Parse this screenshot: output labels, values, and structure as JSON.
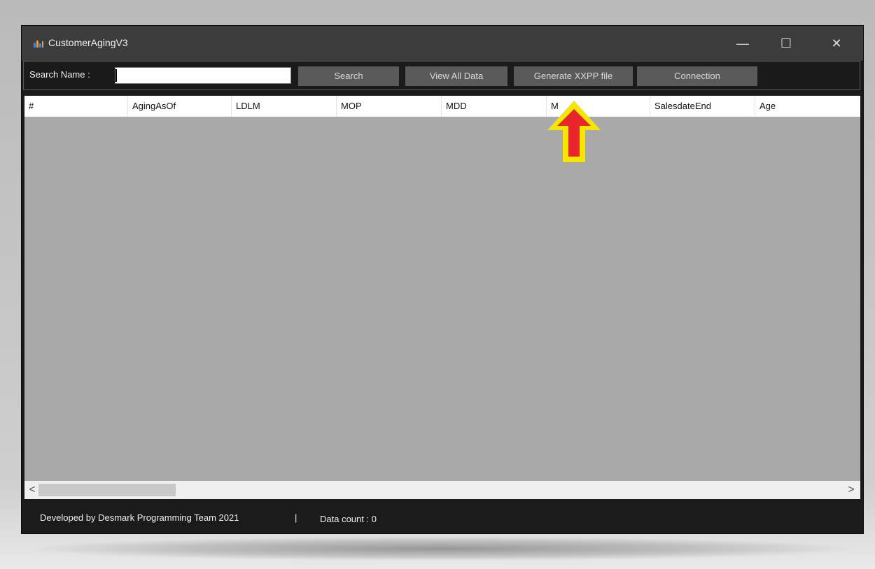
{
  "window": {
    "title": "CustomerAgingV3",
    "minimize_icon": "minimize-icon",
    "maximize_icon": "maximize-icon",
    "close_icon": "close-icon",
    "minimize_glyph": "—",
    "maximize_glyph": "☐",
    "close_glyph": "✕"
  },
  "toolbar": {
    "search_label": "Search Name :",
    "search_value": "",
    "search_button": "Search",
    "view_all_button": "View All Data",
    "generate_button": "Generate XXPP file",
    "connection_button": "Connection"
  },
  "grid": {
    "columns": [
      "#",
      "AgingAsOf",
      "LDLM",
      "MOP",
      "MDD",
      "M",
      "SalesdateEnd",
      "Age"
    ],
    "rows": []
  },
  "scrollbar": {
    "left_glyph": "<",
    "right_glyph": ">"
  },
  "status": {
    "developer": "Developed by Desmark Programming Team 2021",
    "separator": "|",
    "data_count": "Data count : 0"
  },
  "annotation": {
    "icon": "up-arrow-icon",
    "fill_color": "#e8262b",
    "outline_color": "#f5e500"
  },
  "colors": {
    "titlebar": "#3c3c3c",
    "toolbar": "#1a1a1a",
    "button": "#5a5a5a",
    "grid_background": "#a9a9a9"
  }
}
